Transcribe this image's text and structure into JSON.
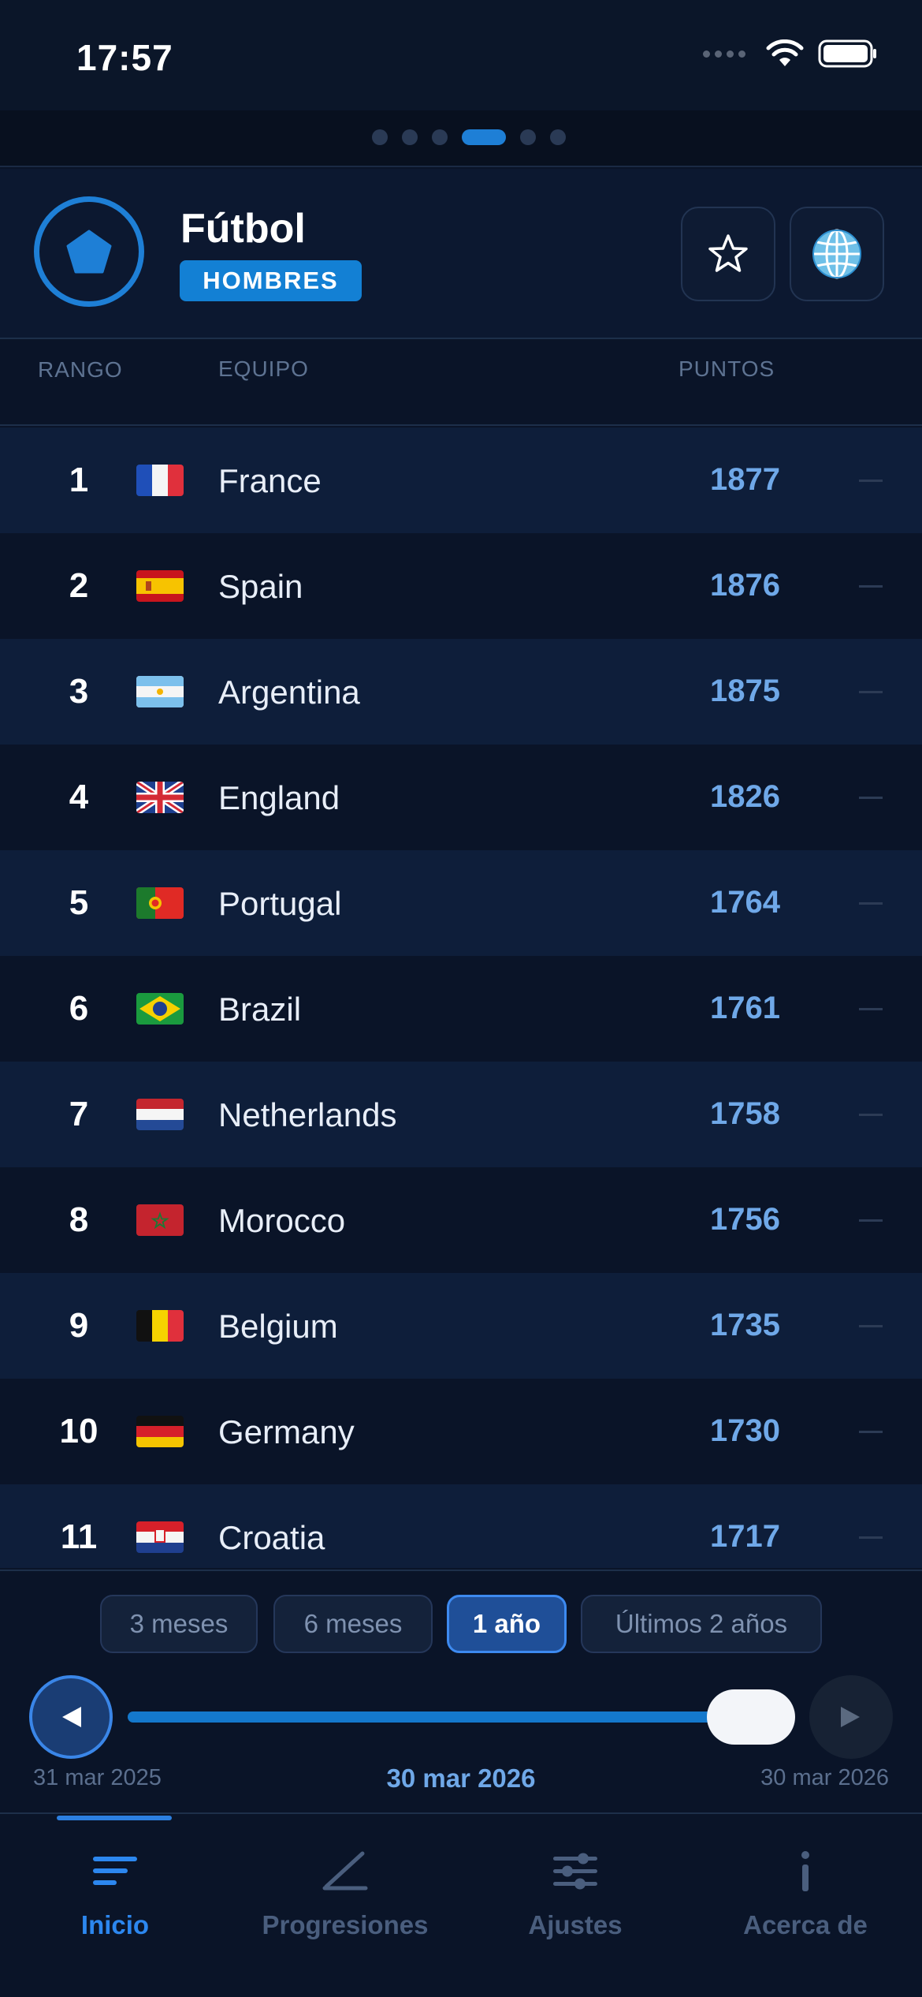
{
  "status_bar": {
    "time": "17:57"
  },
  "header": {
    "sport_title": "Fútbol",
    "gender_badge": "HOMBRES"
  },
  "table": {
    "columns": {
      "rank": "RANGO",
      "team": "EQUIPO",
      "points": "PUNTOS"
    },
    "rows": [
      {
        "rank": "1",
        "team": "France",
        "points": "1877",
        "flag": "france-flag"
      },
      {
        "rank": "2",
        "team": "Spain",
        "points": "1876",
        "flag": "spain-flag"
      },
      {
        "rank": "3",
        "team": "Argentina",
        "points": "1875",
        "flag": "argentina-flag"
      },
      {
        "rank": "4",
        "team": "England",
        "points": "1826",
        "flag": "uk-flag"
      },
      {
        "rank": "5",
        "team": "Portugal",
        "points": "1764",
        "flag": "portugal-flag"
      },
      {
        "rank": "6",
        "team": "Brazil",
        "points": "1761",
        "flag": "brazil-flag"
      },
      {
        "rank": "7",
        "team": "Netherlands",
        "points": "1758",
        "flag": "netherlands-flag"
      },
      {
        "rank": "8",
        "team": "Morocco",
        "points": "1756",
        "flag": "morocco-flag"
      },
      {
        "rank": "9",
        "team": "Belgium",
        "points": "1735",
        "flag": "belgium-flag"
      },
      {
        "rank": "10",
        "team": "Germany",
        "points": "1730",
        "flag": "germany-flag"
      },
      {
        "rank": "11",
        "team": "Croatia",
        "points": "1717",
        "flag": "croatia-flag"
      }
    ]
  },
  "range": {
    "options": [
      "3 meses",
      "6 meses",
      "1 año",
      "Últimos 2 años"
    ],
    "selected": "1 año"
  },
  "timeline": {
    "start_date": "31 mar 2025",
    "current_date": "30 mar 2026",
    "end_date": "30 mar 2026",
    "progress": 1.0
  },
  "tabs": [
    {
      "label": "Inicio",
      "icon": "list-icon",
      "active": true
    },
    {
      "label": "Progresiones",
      "icon": "chart-line-icon",
      "active": false
    },
    {
      "label": "Ajustes",
      "icon": "sliders-icon",
      "active": false
    },
    {
      "label": "Acerca de",
      "icon": "info-icon",
      "active": false
    }
  ],
  "colors": {
    "accent": "#1e7fd6",
    "background": "#0a1428",
    "points": "#6fa8e8"
  }
}
